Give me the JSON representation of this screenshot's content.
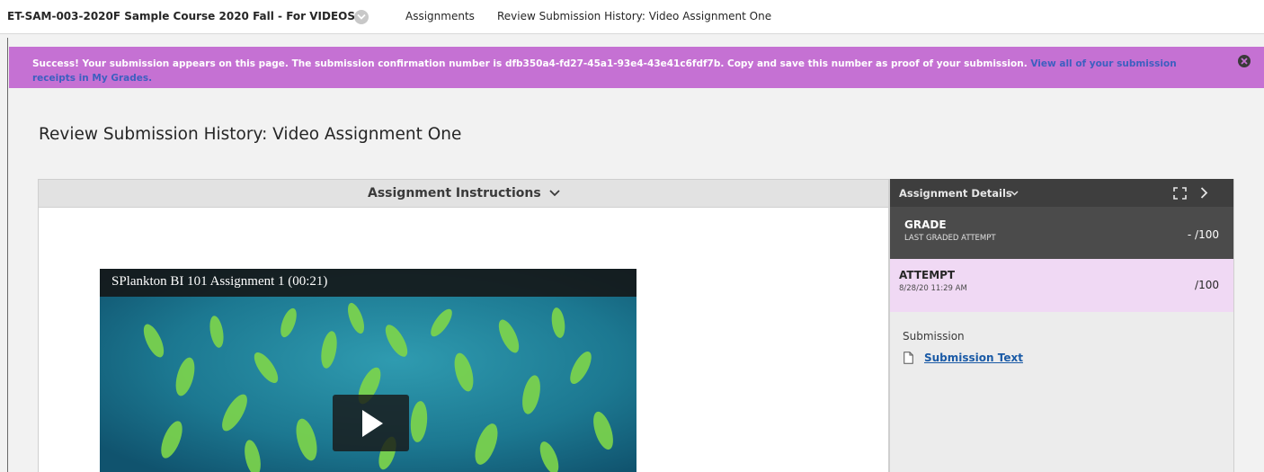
{
  "breadcrumb": {
    "course": "ET-SAM-003-2020F Sample Course 2020 Fall - For VIDEOS",
    "assignments": "Assignments",
    "current": "Review Submission History: Video Assignment One"
  },
  "banner": {
    "message": "Success! Your submission appears on this page. The submission confirmation number is dfb350a4-fd27-45a1-93e4-43e41c6fdf7b. Copy and save this number as proof of your submission. ",
    "link_text": "View all of your submission receipts in My Grades.",
    "close_icon": "close-circle-icon"
  },
  "page": {
    "title": "Review Submission History: Video Assignment One"
  },
  "instructions": {
    "header": "Assignment Instructions",
    "video": {
      "title": "SPlankton BI 101 Assignment 1 (00:21)",
      "play_icon": "play-icon"
    }
  },
  "details": {
    "header": "Assignment Details",
    "grade": {
      "title": "GRADE",
      "subtitle": "LAST GRADED ATTEMPT",
      "score": "- /100"
    },
    "attempt": {
      "title": "ATTEMPT",
      "date": "8/28/20 11:29 AM",
      "score": "/100"
    },
    "submission_label": "Submission",
    "submission_link": "Submission Text"
  },
  "colors": {
    "banner_bg": "#c571d3",
    "banner_link": "#3d5fc0",
    "details_header_bg": "#3e3e3e",
    "grade_bg": "#4b4b4b",
    "attempt_bg": "#f0d9f4",
    "link": "#1a5aa6"
  }
}
